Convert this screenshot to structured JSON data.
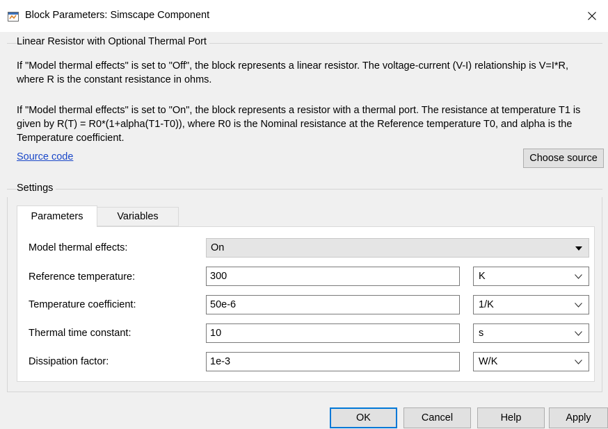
{
  "window": {
    "title": "Block Parameters: Simscape Component",
    "icon": "simulink-block-icon",
    "close_icon": "close-icon"
  },
  "description": {
    "group_title": "Linear Resistor with Optional Thermal Port",
    "paragraph1": "If \"Model thermal effects\" is set to \"Off\", the block represents a linear resistor. The voltage-current (V-I) relationship is V=I*R, where R is the constant resistance in ohms.",
    "paragraph2": "If \"Model thermal effects\" is set to \"On\", the block represents a resistor with a thermal port. The resistance at temperature T1 is given by R(T) = R0*(1+alpha(T1-T0)), where R0 is the Nominal resistance at the Reference temperature T0, and alpha is the Temperature coefficient.",
    "source_link": "Source code",
    "choose_source": "Choose source"
  },
  "settings": {
    "group_title": "Settings",
    "tabs": [
      {
        "label": "Parameters",
        "active": true
      },
      {
        "label": "Variables",
        "active": false
      }
    ],
    "model_thermal": {
      "label": "Model thermal effects:",
      "value": "On"
    },
    "params": [
      {
        "label": "Reference temperature:",
        "value": "300",
        "unit": "K"
      },
      {
        "label": "Temperature coefficient:",
        "value": "50e-6",
        "unit": "1/K"
      },
      {
        "label": "Thermal time constant:",
        "value": "10",
        "unit": "s"
      },
      {
        "label": "Dissipation factor:",
        "value": "1e-3",
        "unit": "W/K"
      }
    ]
  },
  "footer": {
    "ok": "OK",
    "cancel": "Cancel",
    "help": "Help",
    "apply": "Apply"
  }
}
